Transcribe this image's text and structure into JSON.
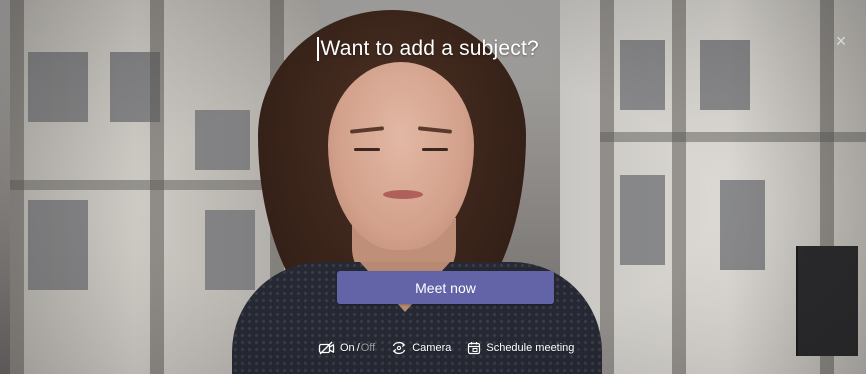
{
  "subject": {
    "placeholder": "Want to add a subject?"
  },
  "close": {
    "glyph": "×",
    "icon": "close-icon"
  },
  "meet_button": {
    "label": "Meet now"
  },
  "options": {
    "video_toggle": {
      "on_label": "On",
      "separator": "/",
      "off_label": "Off",
      "icon": "video-off-icon"
    },
    "camera": {
      "label": "Camera",
      "icon": "camera-switch-icon"
    },
    "schedule": {
      "label": "Schedule meeting",
      "icon": "calendar-icon"
    }
  },
  "colors": {
    "accent": "#6264a7",
    "text": "#ffffff"
  }
}
